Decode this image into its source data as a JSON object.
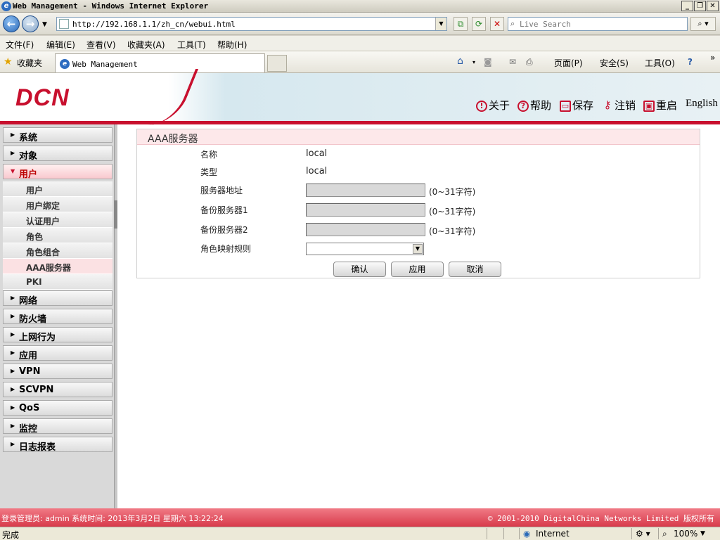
{
  "window": {
    "title": "Web Management - Windows Internet Explorer",
    "address": "http://192.168.1.1/zh_cn/webui.html",
    "search_placeholder": "Live Search"
  },
  "menubar": [
    "文件(F)",
    "编辑(E)",
    "查看(V)",
    "收藏夹(A)",
    "工具(T)",
    "帮助(H)"
  ],
  "favbar": {
    "favorites_label": "收藏夹",
    "tab_title": "Web Management",
    "page_menu": "页面(P)",
    "safety_menu": "安全(S)",
    "tools_menu": "工具(O)"
  },
  "header": {
    "logo": "DCN",
    "links": {
      "about": "关于",
      "help": "帮助",
      "save": "保存",
      "logout": "注销",
      "reboot": "重启",
      "language": "English"
    }
  },
  "sidebar": {
    "main": [
      "系统",
      "对象",
      "用户",
      "网络",
      "防火墙",
      "上网行为",
      "应用",
      "VPN",
      "SCVPN",
      "QoS",
      "监控",
      "日志报表"
    ],
    "sub": [
      "用户",
      "用户绑定",
      "认证用户",
      "角色",
      "角色组合",
      "AAA服务器",
      "PKI"
    ]
  },
  "form": {
    "title": "AAA服务器",
    "name_label": "名称",
    "name_value": "local",
    "type_label": "类型",
    "type_value": "local",
    "server_label": "服务器地址",
    "backup1_label": "备份服务器1",
    "backup2_label": "备份服务器2",
    "hint": "(0~31字符)",
    "role_map_label": "角色映射规则",
    "role_map_value": "",
    "ok": "确认",
    "apply": "应用",
    "cancel": "取消"
  },
  "footer": {
    "left": "登录管理员: admin 系统时间: 2013年3月2日 星期六 13:22:24",
    "right": "© 2001-2010 DigitalChina Networks Limited 版权所有"
  },
  "status": {
    "done": "完成",
    "zone": "Internet",
    "zoom": "100%"
  }
}
